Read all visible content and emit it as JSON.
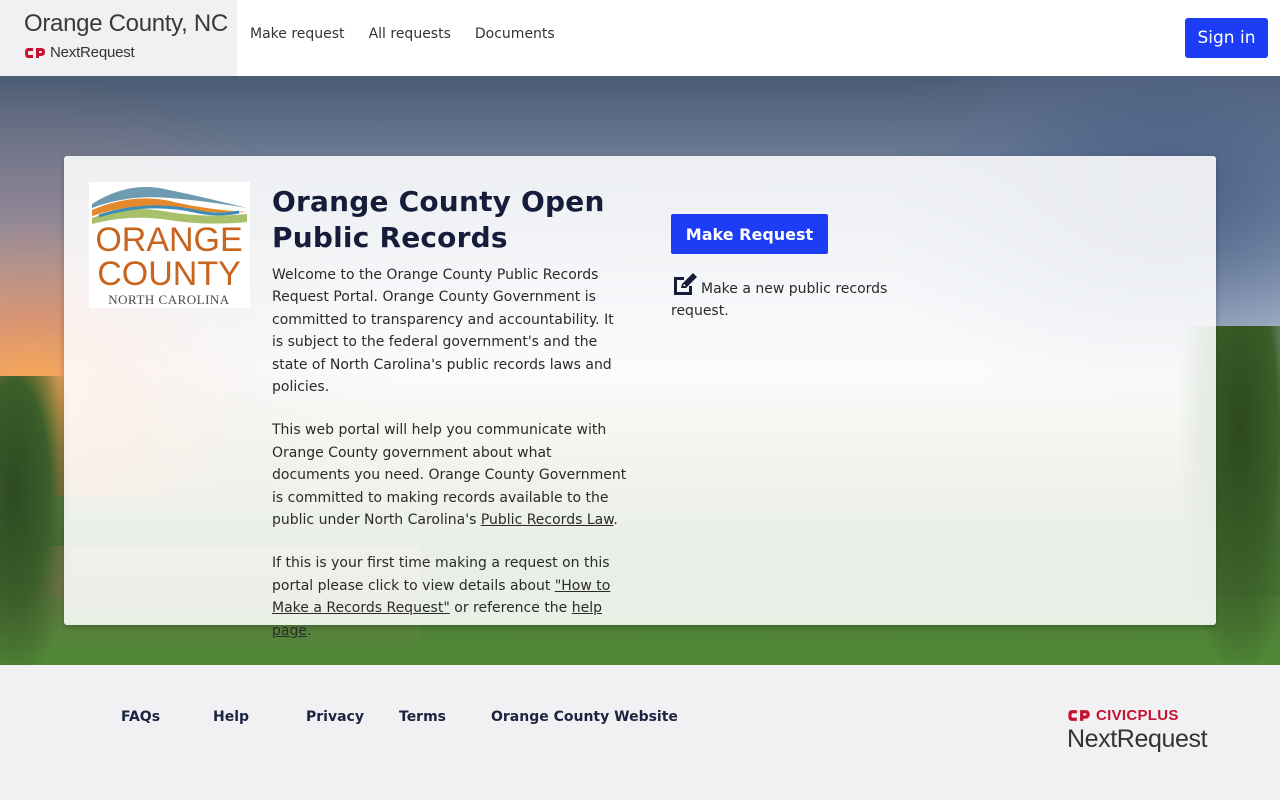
{
  "header": {
    "title": "Orange County, NC",
    "product": "NextRequest",
    "nav": [
      "Make request",
      "All requests",
      "Documents"
    ],
    "sign_in": "Sign in"
  },
  "logo": {
    "line1": "ORANGE",
    "line2": "COUNTY",
    "line3": "NORTH CAROLINA"
  },
  "main": {
    "title": "Orange County Open Public Records",
    "p1": "Welcome to the Orange County Public Records Request Portal. Orange County Government is committed to transparency and accountability. It is subject to the federal government's and the state of North Carolina's public records laws and policies.",
    "p2_text": "This web portal will help you communicate with Orange County government about what documents you need. Orange County Government is committed to making records available to the public under North Carolina's ",
    "p2_link": "Public Records Law",
    "p2_end": ".",
    "p3_text": "If this is your first time making a request on this portal please click to view details about ",
    "p3_link1": "\"How to Make a Records Request\"",
    "p3_mid": " or reference the ",
    "p3_link2": "help page",
    "p3_end": ".",
    "make_request_button": "Make Request",
    "make_request_desc": "Make a new public records request."
  },
  "footer": {
    "links": [
      "FAQs",
      "Help",
      "Privacy",
      "Terms",
      "Orange County Website"
    ],
    "civicplus": "CIVICPLUS",
    "nextrequest": "NextRequest"
  },
  "colors": {
    "primary": "#1c3df5",
    "brand_red": "#c4122f",
    "logo_orange": "#c8641e",
    "title_navy": "#161d3a"
  }
}
